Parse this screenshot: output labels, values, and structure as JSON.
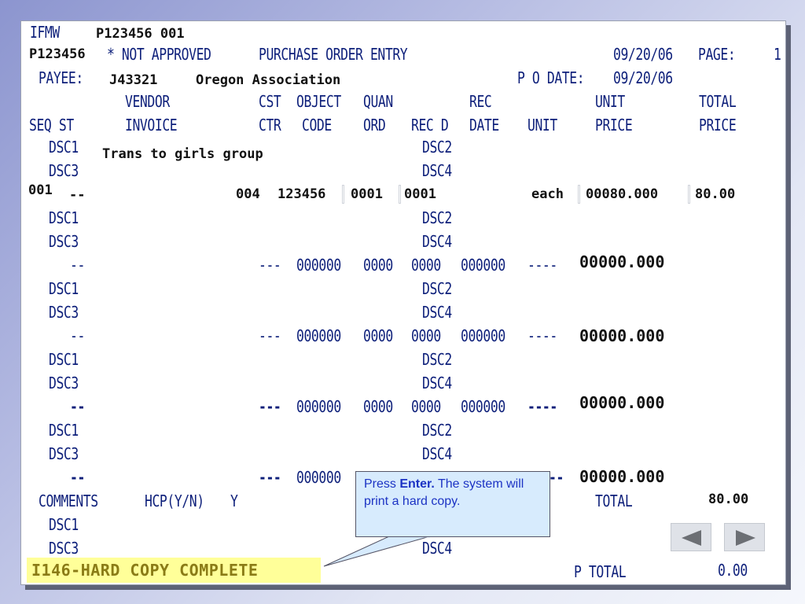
{
  "screen": {
    "system_id": "IFMW",
    "header_id": "P123456 001",
    "user_id": "P123456",
    "approval_status": "* NOT APPROVED",
    "screen_title": "PURCHASE ORDER ENTRY",
    "date": "09/20/06",
    "page_label": "PAGE:",
    "page_number": "1"
  },
  "payee": {
    "label": "PAYEE:",
    "code": "J43321",
    "name": "Oregon Association",
    "po_date_label": "P O DATE:",
    "po_date": "09/20/06"
  },
  "columns": {
    "row1": {
      "vendor": "VENDOR",
      "cst": "CST",
      "object": "OBJECT",
      "quan": "QUAN",
      "rec": "REC",
      "unit": "UNIT",
      "total": "TOTAL"
    },
    "row2": {
      "seq_st": "SEQ ST",
      "invoice": "INVOICE",
      "ctr": "CTR",
      "code": "CODE",
      "ord": "ORD",
      "rec_d": "REC D",
      "date": "DATE",
      "unit": "UNIT",
      "price": "PRICE",
      "total_price": "PRICE"
    }
  },
  "header_desc": {
    "dsc1": "DSC1",
    "dsc2": "DSC2",
    "dsc3": "DSC3",
    "dsc4": "DSC4",
    "dsc1_value": "Trans to girls group"
  },
  "line1": {
    "seq": "001",
    "st": "--",
    "cst": "004",
    "object": "123456",
    "quan": "0001",
    "rec_d": "0001",
    "unit": "each",
    "unit_price": "00080.000",
    "total_price": "80.00",
    "dsc1": "DSC1",
    "dsc2": "DSC2",
    "dsc3": "DSC3",
    "dsc4": "DSC4"
  },
  "blank_lines": [
    {
      "st": "--",
      "cst": "---",
      "object": "000000",
      "quan": "0000",
      "rec_d": "0000",
      "rec_date": "000000",
      "unit": "----",
      "unit_price": "00000.000",
      "dsc1": "DSC1",
      "dsc2": "DSC2",
      "dsc3": "DSC3",
      "dsc4": "DSC4"
    },
    {
      "st": "--",
      "cst": "---",
      "object": "000000",
      "quan": "0000",
      "rec_d": "0000",
      "rec_date": "000000",
      "unit": "----",
      "unit_price": "00000.000",
      "dsc1": "DSC1",
      "dsc2": "DSC2",
      "dsc3": "DSC3",
      "dsc4": "DSC4"
    },
    {
      "st": "--",
      "cst": "---",
      "object": "000000",
      "quan": "0000",
      "rec_d": "0000",
      "rec_date": "000000",
      "unit": "----",
      "unit_price": "00000.000",
      "dsc1": "DSC1",
      "dsc2": "DSC2",
      "dsc3": "DSC3",
      "dsc4": "DSC4"
    },
    {
      "st": "--",
      "cst": "---",
      "object": "000000",
      "unit_trailing": "--",
      "unit_price": "00000.000"
    }
  ],
  "footer": {
    "comments_label": "COMMENTS",
    "hcp_label": "HCP(Y/N)",
    "hcp_value": "Y",
    "total_label": "TOTAL",
    "total_value": "80.00",
    "dsc1": "DSC1",
    "dsc3": "DSC3",
    "dsc4": "DSC4",
    "p_total_label": "P TOTAL",
    "p_total_value": "0.00"
  },
  "status_message": "I146-HARD COPY COMPLETE",
  "callout": {
    "prefix": "Press ",
    "key": "Enter.",
    "suffix": " The system will print a hard copy."
  },
  "nav": {
    "prev_icon": "triangle-left-icon",
    "next_icon": "triangle-right-icon"
  },
  "colors": {
    "screen_text": "#0d1f7a",
    "field_text": "#111111",
    "status_bg": "#ffff99",
    "status_text": "#8a7b16",
    "callout_bg": "#d7ebfd",
    "callout_text": "#1c33c4"
  }
}
